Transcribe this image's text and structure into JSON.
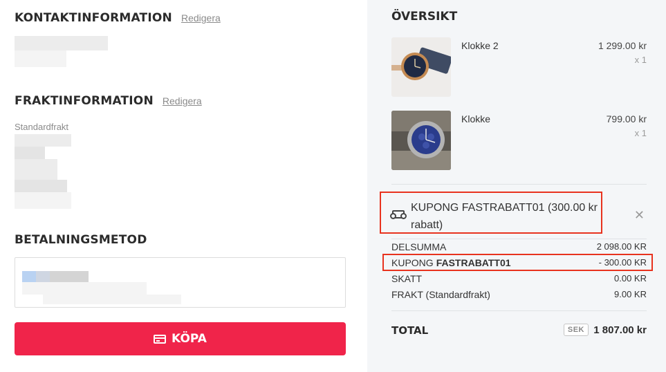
{
  "contact": {
    "title": "KONTAKTINFORMATION",
    "edit_label": "Redigera"
  },
  "shipping": {
    "title": "FRAKTINFORMATION",
    "edit_label": "Redigera",
    "method": "Standardfrakt"
  },
  "payment": {
    "title": "BETALNINGSMETOD"
  },
  "buy_button": {
    "label": "KÖPA",
    "icon": "credit-card-icon",
    "color": "#f0244a"
  },
  "overview": {
    "title": "ÖVERSIKT",
    "items": [
      {
        "name": "Klokke 2",
        "price": "1 299.00 kr",
        "qty": "x 1"
      },
      {
        "name": "Klokke",
        "price": "799.00 kr",
        "qty": "x 1"
      }
    ],
    "coupon": {
      "text": "KUPONG FASTRABATT01 (300.00 kr rabatt)",
      "icon": "ticket-icon",
      "remove_icon": "close-icon"
    },
    "summary": {
      "subtotal_label": "DELSUMMA",
      "subtotal_value": "2 098.00 KR",
      "coupon_label": "KUPONG",
      "coupon_code": "FASTRABATT01",
      "coupon_value": "- 300.00 KR",
      "tax_label": "SKATT",
      "tax_value": "0.00 KR",
      "shipping_label": "FRAKT (Standardfrakt)",
      "shipping_value": "9.00 KR"
    },
    "total": {
      "label": "TOTAL",
      "currency": "SEK",
      "value": "1 807.00 kr"
    }
  },
  "colors": {
    "highlight": "#e8321e",
    "panel_bg": "#f4f6f8"
  }
}
